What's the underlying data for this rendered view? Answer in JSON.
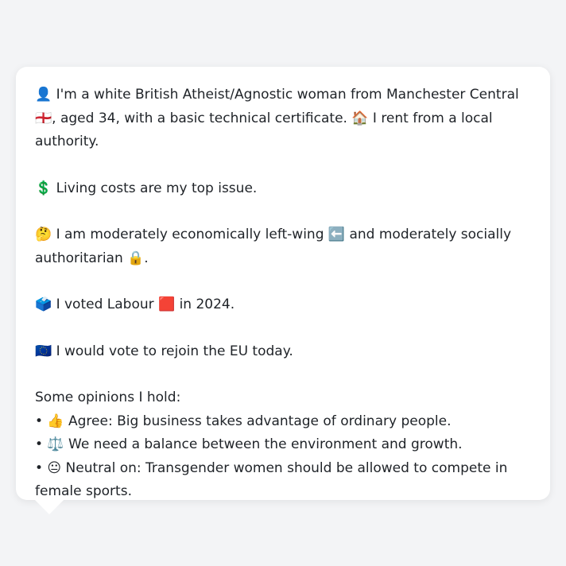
{
  "card": {
    "profile": "👤 I'm a white British Atheist/Agnostic woman from Manchester Central 🏴󠁧󠁢󠁥󠁮󠁧󠁿, aged 34, with a basic technical certificate. 🏠 I rent from a local authority.",
    "issue": "💲 Living costs are my top issue.",
    "ideology": "🤔 I am moderately economically left-wing ⬅️ and moderately socially authoritarian 🔒.",
    "vote": "🗳️ I voted Labour 🟥 in 2024.",
    "eu": "🇪🇺 I would vote to rejoin the EU today.",
    "opinions_heading": "Some opinions I hold:",
    "opinions": [
      "• 👍 Agree: Big business takes advantage of ordinary people.",
      "• ⚖️ We need a balance between the environment and growth.",
      "• 😐 Neutral on: Transgender women should be allowed to compete in female sports."
    ]
  }
}
